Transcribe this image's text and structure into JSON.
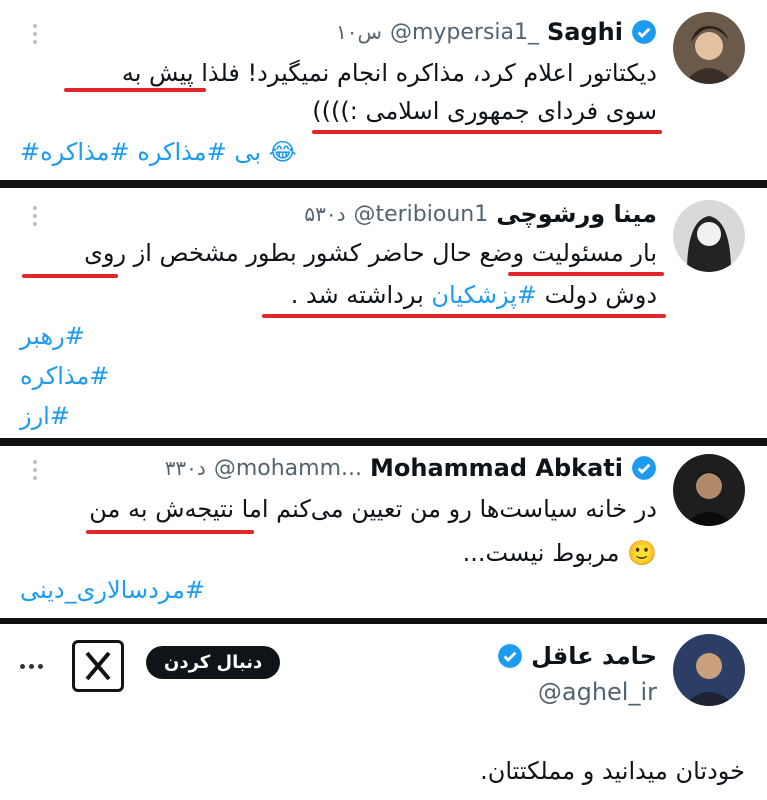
{
  "tweets": [
    {
      "name": "Saghi",
      "handle": "@mypersia1_",
      "time": "۱۰س",
      "line1": "دیکتاتور اعلام کرد، مذاکره انجام نمیگیرد! فلذا پیش به",
      "line2": "سوی فردای جمهوری اسلامی :))))",
      "hashtags": "#بی #مذاکره #مذاکره",
      "emoji": "😂"
    },
    {
      "name": "مینا ورشوچی",
      "handle": "@teribioun1",
      "time": "۵۳۰د",
      "line1": "بار مسئولیت وضع حال حاضر کشور بطور مشخص از روی",
      "line2_pre": "دوش دولت",
      "line2_tag": "#پزشکیان",
      "line2_post": "برداشته شد .",
      "hashtag_lines": [
        "#رهبر",
        "#مذاکره",
        "#ارز"
      ]
    },
    {
      "name": "Mohammad Abkati",
      "handle": "@mohamm...",
      "time": "۳۳۰د",
      "line1": "در خانه سیاست‌ها رو من تعیین می‌کنم اما نتیجه‌ش به من",
      "line2": "مربوط نیست...",
      "emoji": "🙂",
      "hashtags": "#مردسالاری_دینی"
    },
    {
      "name": "حامد عاقل",
      "handle": "@aghel_ir",
      "follow_label": "دنبال کردن",
      "body": "خودتان میدانید و مملکتتان."
    }
  ],
  "colors": {
    "underline": "#e0262a",
    "link": "#1d9bf0",
    "verified": "#1d9bf0"
  }
}
